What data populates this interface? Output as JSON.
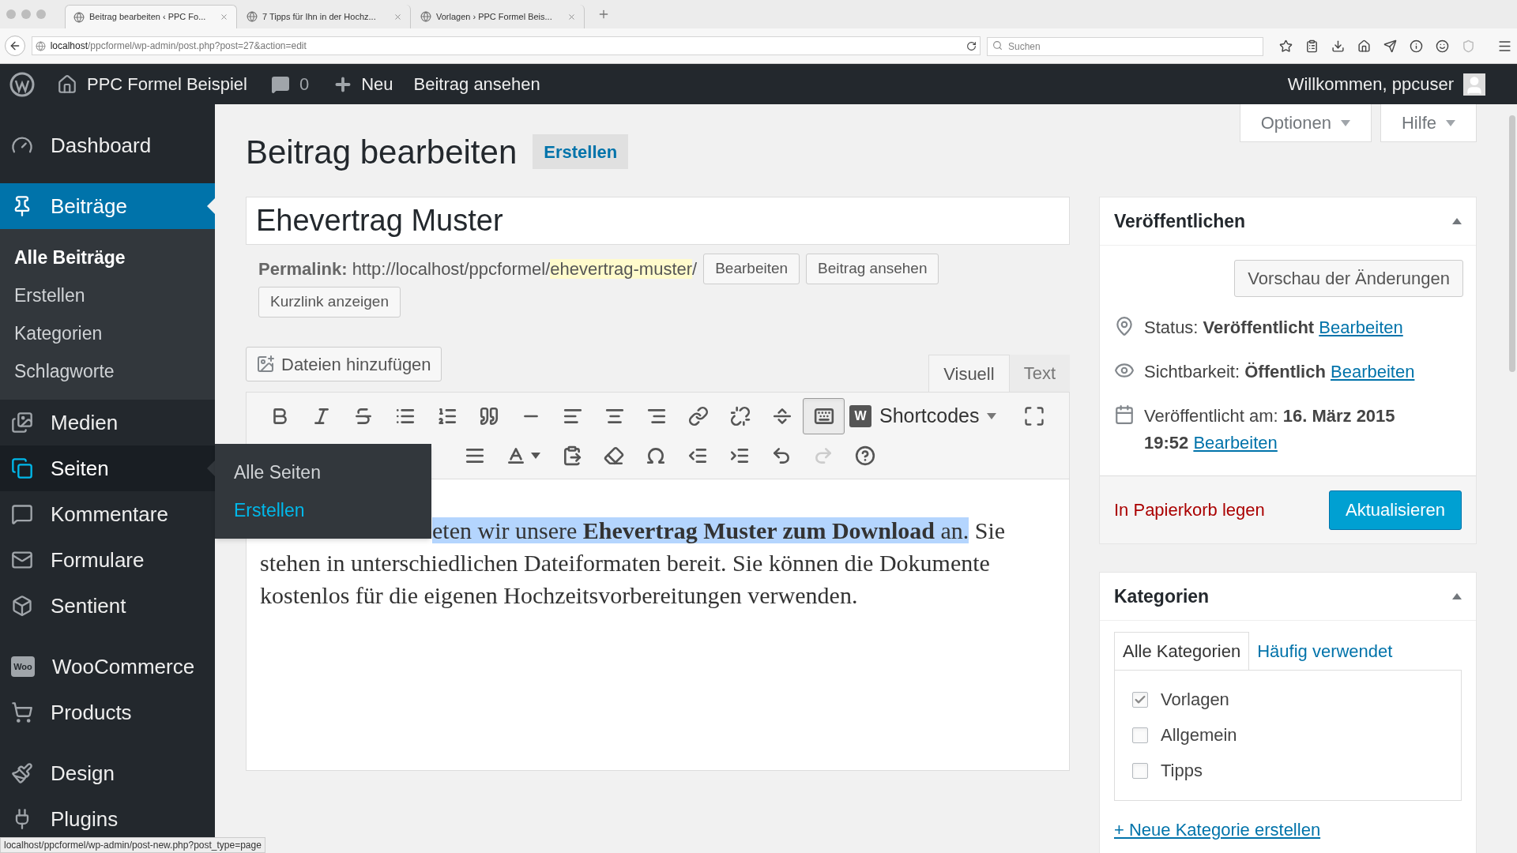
{
  "browser": {
    "tabs": [
      {
        "title": "Beitrag bearbeiten ‹ PPC Fo...",
        "selected": true
      },
      {
        "title": "7 Tipps für Ihn in der Hochz...",
        "selected": false
      },
      {
        "title": "Vorlagen › PPC Formel Beis...",
        "selected": false
      }
    ],
    "url_host": "localhost",
    "url_path": "/ppcformel/wp-admin/post.php?post=27&action=edit",
    "search": {
      "placeholder": "Suchen"
    }
  },
  "admin_bar": {
    "site": "PPC Formel Beispiel",
    "comments": "0",
    "new": "Neu",
    "view": "Beitrag ansehen",
    "greeting": "Willkommen, ppcuser"
  },
  "sidebar": {
    "groups": [
      [
        {
          "label": "Dashboard",
          "selected": false,
          "hovered": false
        }
      ],
      [
        {
          "label": "Beiträge",
          "selected": true,
          "hovered": false,
          "children": [
            {
              "label": "Alle Beiträge",
              "selected": true
            },
            {
              "label": "Erstellen",
              "selected": false
            },
            {
              "label": "Kategorien",
              "selected": false
            },
            {
              "label": "Schlagworte",
              "selected": false
            }
          ]
        },
        {
          "label": "Medien",
          "selected": false,
          "hovered": false
        },
        {
          "label": "Seiten",
          "selected": false,
          "hovered": true,
          "flyout": [
            {
              "label": "Alle Seiten",
              "hovered": false
            },
            {
              "label": "Erstellen",
              "hovered": true
            }
          ]
        },
        {
          "label": "Kommentare",
          "selected": false,
          "hovered": false
        },
        {
          "label": "Formulare",
          "selected": false,
          "hovered": false
        },
        {
          "label": "Sentient",
          "selected": false,
          "hovered": false
        }
      ],
      [
        {
          "label": "WooCommerce",
          "selected": false,
          "hovered": false,
          "icon_text": "Woo"
        },
        {
          "label": "Products",
          "selected": false,
          "hovered": false
        }
      ],
      [
        {
          "label": "Design",
          "selected": false,
          "hovered": false
        },
        {
          "label": "Plugins",
          "selected": false,
          "hovered": false
        }
      ]
    ]
  },
  "screen_options": [
    "Optionen",
    "Hilfe"
  ],
  "page": {
    "title": "Beitrag bearbeiten",
    "add_new": "Erstellen"
  },
  "post": {
    "title": "Ehevertrag Muster",
    "permalink_label": "Permalink:",
    "permalink_base": "http://localhost/ppcformel/",
    "permalink_slug": "ehevertrag-muster",
    "permalink_end": "/",
    "permalink_buttons": [
      "Bearbeiten",
      "Beitrag ansehen",
      "Kurzlink anzeigen"
    ],
    "add_media": "Dateien hinzufügen",
    "editor_tabs": [
      {
        "label": "Visuell",
        "selected": true
      },
      {
        "label": "Text",
        "selected": false
      }
    ],
    "toolbar_row1": [
      {
        "pressed": false
      },
      {
        "pressed": false
      },
      {
        "pressed": false
      },
      {
        "pressed": false
      },
      {
        "pressed": false
      },
      {
        "pressed": false
      },
      {
        "pressed": false
      },
      {
        "pressed": false
      },
      {
        "pressed": false
      },
      {
        "pressed": false
      },
      {
        "pressed": false
      },
      {
        "pressed": false
      },
      {
        "pressed": false
      },
      {
        "pressed": true
      }
    ],
    "shortcodes": {
      "icon_text": "W",
      "label": "Shortcodes"
    },
    "toolbar_row2": [
      {
        "disabled": false
      },
      {
        "disabled": false
      },
      {
        "disabled": false
      },
      {
        "disabled": false
      },
      {
        "disabled": false
      },
      {
        "disabled": false
      },
      {
        "disabled": false
      },
      {
        "disabled": false
      },
      {
        "disabled": true
      },
      {
        "disabled": false
      }
    ],
    "content": [
      {
        "highlighted": "eten wir unsere **Ehevertrag Muster zum Download** an.",
        "text": "Sie"
      },
      {
        "text": "stehen in unterschiedlichen Dateiformaten bereit. Sie können die Dokumente"
      },
      {
        "text": "kostenlos für die eigenen Hochzeitsvorbereitungen verwenden."
      }
    ]
  },
  "publish": {
    "title": "Veröffentlichen",
    "preview": "Vorschau der Änderungen",
    "rows": [
      {
        "label": "Status:",
        "value": "Veröffentlicht",
        "link": "Bearbeiten"
      },
      {
        "label": "Sichtbarkeit:",
        "value": "Öffentlich",
        "link": "Bearbeiten"
      },
      {
        "label": "Veröffentlicht am:",
        "value": "16. März 2015",
        "value_line2": "19:52",
        "link": "Bearbeiten"
      }
    ],
    "trash": "In Papierkorb legen",
    "update": "Aktualisieren"
  },
  "categories": {
    "title": "Kategorien",
    "tabs": [
      {
        "label": "Alle Kategorien",
        "selected": true
      },
      {
        "label": "Häufig verwendet",
        "selected": false
      }
    ],
    "items": [
      {
        "label": "Vorlagen",
        "checked": true
      },
      {
        "label": "Allgemein",
        "checked": false
      },
      {
        "label": "Tipps",
        "checked": false
      }
    ],
    "add_link": "+ Neue Kategorie erstellen"
  },
  "status_bar": "localhost/ppcformel/wp-admin/post-new.php?post_type=page"
}
